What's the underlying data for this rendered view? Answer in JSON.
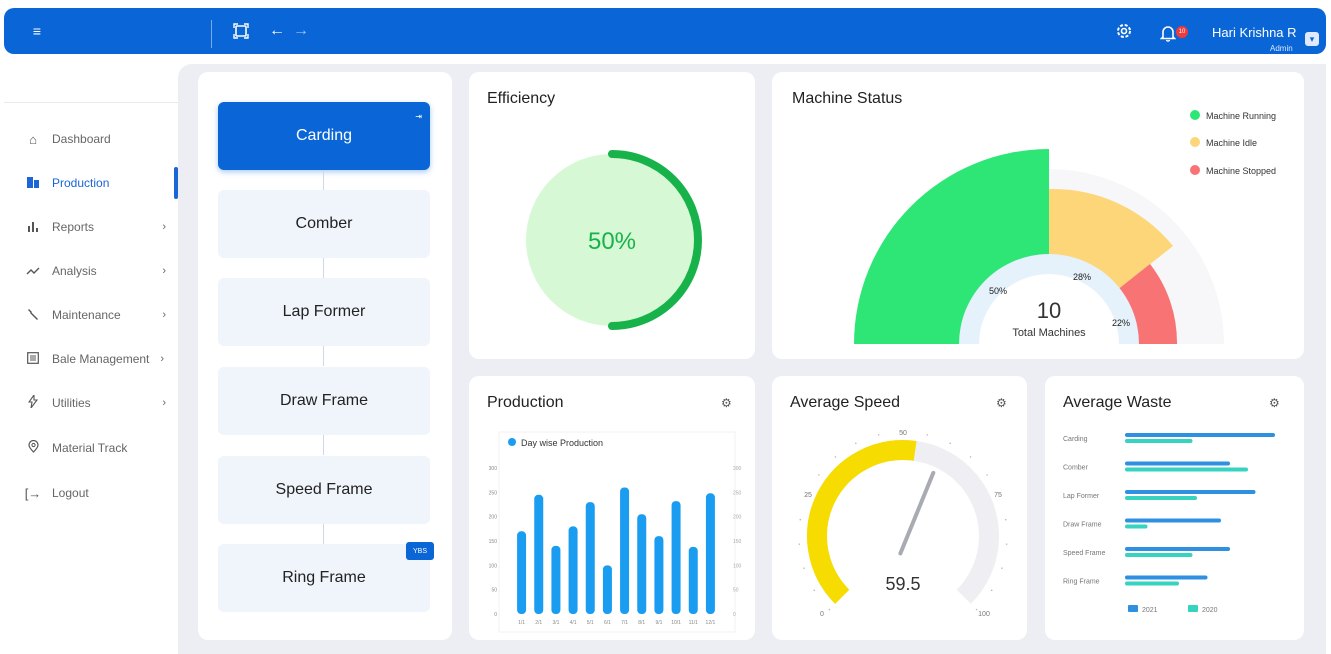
{
  "topbar": {
    "user_name": "Hari Krishna R",
    "user_role": "Admin",
    "notification_count": "10"
  },
  "sidebar": {
    "items": [
      {
        "label": "Dashboard",
        "icon": "home-icon",
        "active": false,
        "has_submenu": false
      },
      {
        "label": "Production",
        "icon": "building-icon",
        "active": true,
        "has_submenu": false
      },
      {
        "label": "Reports",
        "icon": "bar-chart-icon",
        "active": false,
        "has_submenu": true
      },
      {
        "label": "Analysis",
        "icon": "trend-icon",
        "active": false,
        "has_submenu": true
      },
      {
        "label": "Maintenance",
        "icon": "wrench-icon",
        "active": false,
        "has_submenu": true
      },
      {
        "label": "Bale Management",
        "icon": "list-icon",
        "active": false,
        "has_submenu": true
      },
      {
        "label": "Utilities",
        "icon": "bolt-icon",
        "active": false,
        "has_submenu": true
      },
      {
        "label": "Material Track",
        "icon": "location-pin-icon",
        "active": false,
        "has_submenu": false
      },
      {
        "label": "Logout",
        "icon": "logout-icon",
        "active": false,
        "has_submenu": false
      }
    ]
  },
  "process": {
    "items": [
      "Carding",
      "Comber",
      "Lap Former",
      "Draw Frame",
      "Speed Frame",
      "Ring Frame"
    ],
    "ring_frame_tag": "YBS"
  },
  "efficiency": {
    "title": "Efficiency",
    "value_label": "50%",
    "value": 50
  },
  "machine_status": {
    "title": "Machine Status",
    "legend": [
      {
        "label": "Machine Running",
        "color": "#2ee675"
      },
      {
        "label": "Machine Idle",
        "color": "#fcd679"
      },
      {
        "label": "Machine Stopped",
        "color": "#f87374"
      }
    ],
    "total": "10",
    "total_label": "Total Machines",
    "pct_running": "50%",
    "pct_idle": "28%",
    "pct_stopped": "22%"
  },
  "production": {
    "title": "Production",
    "legend_label": "Day wise Production"
  },
  "average_speed": {
    "title": "Average Speed",
    "value": "59.5",
    "ticks": [
      "0",
      "25",
      "50",
      "75",
      "100"
    ]
  },
  "average_waste": {
    "title": "Average Waste",
    "categories": [
      "Carding",
      "Comber",
      "Lap Former",
      "Draw Frame",
      "Speed Frame",
      "Ring Frame"
    ],
    "legend": [
      "2021",
      "2020"
    ]
  },
  "colors": {
    "brand": "#0a66d6",
    "running": "#2ee675",
    "idle": "#fcd679",
    "stopped": "#f87374",
    "bar": "#1a9cf0",
    "series_2021": "#2f8fe0",
    "series_2020": "#35d3c0",
    "gauge": "#f6dc00"
  },
  "chart_data": [
    {
      "type": "bar",
      "title": "Production",
      "categories": [
        "1/1",
        "2/1",
        "3/1",
        "4/1",
        "5/1",
        "6/1",
        "7/1",
        "8/1",
        "9/1",
        "10/1",
        "11/1",
        "12/1"
      ],
      "series": [
        {
          "name": "Day wise Production",
          "values": [
            170,
            245,
            140,
            180,
            230,
            100,
            260,
            205,
            160,
            232,
            138,
            248
          ]
        }
      ],
      "y_ticks": [
        "0",
        "50",
        "100",
        "150",
        "200",
        "250",
        "300"
      ],
      "ylim": [
        0,
        300
      ]
    },
    {
      "type": "bar",
      "title": "Average Waste",
      "categories": [
        "Carding",
        "Comber",
        "Lap Former",
        "Draw Frame",
        "Speed Frame",
        "Ring Frame"
      ],
      "series": [
        {
          "name": "2021",
          "values": [
            100,
            70,
            87,
            64,
            70,
            55
          ]
        },
        {
          "name": "2020",
          "values": [
            45,
            82,
            48,
            15,
            45,
            36
          ]
        }
      ],
      "orientation": "horizontal"
    }
  ]
}
